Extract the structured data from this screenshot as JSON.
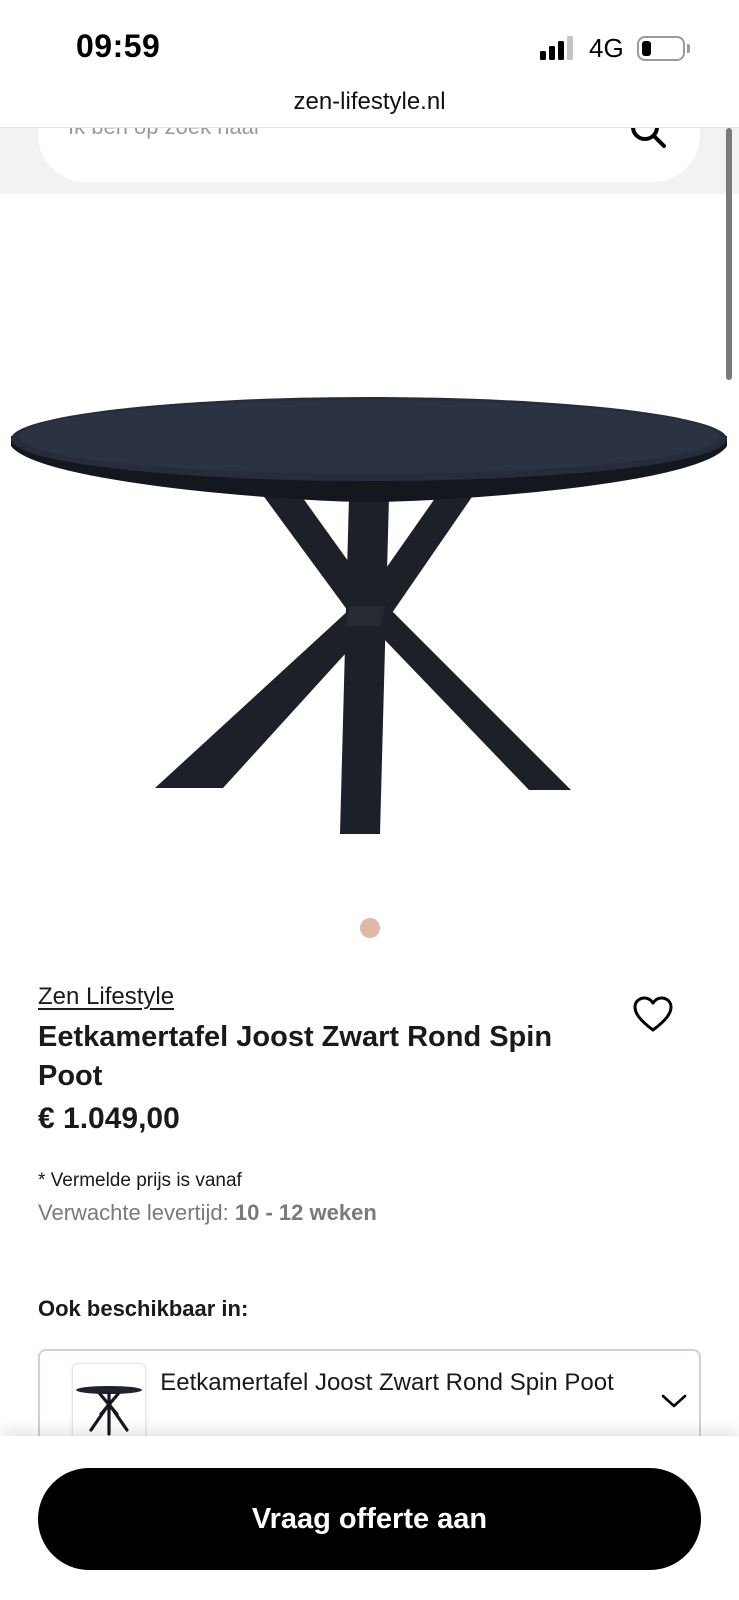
{
  "status_bar": {
    "time": "09:59",
    "network": "4G",
    "battery_level": 0.2
  },
  "browser": {
    "url": "zen-lifestyle.nl"
  },
  "search": {
    "placeholder": "Ik ben op zoek naar",
    "icon": "search-icon"
  },
  "carousel": {
    "active_dot_color": "#e0b8a6",
    "slides": 1,
    "active_index": 0
  },
  "product": {
    "brand": "Zen Lifestyle",
    "title": "Eetkamertafel Joost Zwart Rond Spin Poot",
    "price": "€ 1.049,00",
    "price_note": "* Vermelde prijs is vanaf",
    "delivery_label": "Verwachte levertijd:",
    "delivery_value": "10 - 12 weken",
    "favorite_icon": "heart-icon"
  },
  "variants": {
    "heading": "Ook beschikbaar in:",
    "selected": "Eetkamertafel Joost Zwart Rond Spin Poot",
    "icon": "chevron-down-icon"
  },
  "cta": {
    "label": "Vraag offerte aan",
    "background": "#000000",
    "text_color": "#ffffff"
  }
}
